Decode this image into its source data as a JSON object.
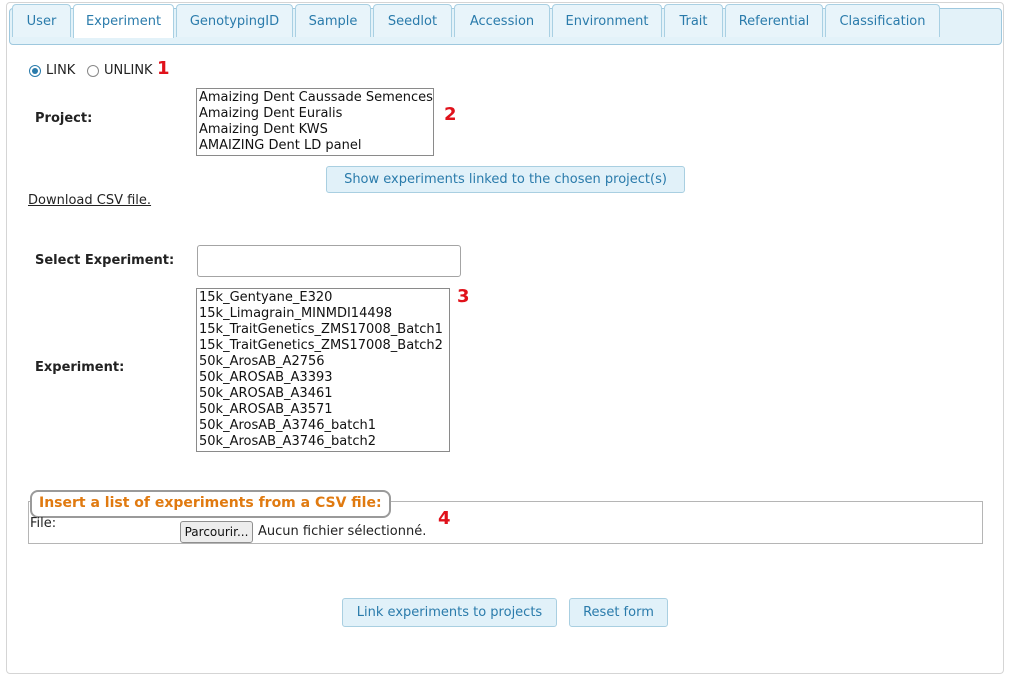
{
  "tabs": [
    {
      "label": "User",
      "active": false
    },
    {
      "label": "Experiment",
      "active": true
    },
    {
      "label": "GenotypingID",
      "active": false
    },
    {
      "label": "Sample",
      "active": false
    },
    {
      "label": "Seedlot",
      "active": false
    },
    {
      "label": "Accession",
      "active": false
    },
    {
      "label": "Environment",
      "active": false
    },
    {
      "label": "Trait",
      "active": false
    },
    {
      "label": "Referential",
      "active": false
    },
    {
      "label": "Classification",
      "active": false
    }
  ],
  "mode": {
    "link_label": "LINK",
    "unlink_label": "UNLINK",
    "selected": "LINK"
  },
  "markers": [
    "1",
    "2",
    "3",
    "4"
  ],
  "project": {
    "label": "Project:",
    "options": [
      "Amaizing Dent Caussade Semences",
      "Amaizing Dent Euralis",
      "Amaizing Dent KWS",
      "AMAIZING Dent LD panel"
    ],
    "show_button": "Show experiments linked to the chosen project(s)"
  },
  "download_link": "Download CSV file.",
  "select_experiment": {
    "label": "Select Experiment:",
    "value": ""
  },
  "experiment": {
    "label": "Experiment:",
    "options": [
      "15k_Gentyane_E320",
      "15k_Limagrain_MINMDI14498",
      "15k_TraitGenetics_ZMS17008_Batch1",
      "15k_TraitGenetics_ZMS17008_Batch2",
      "50k_ArosAB_A2756",
      "50k_AROSAB_A3393",
      "50k_AROSAB_A3461",
      "50k_AROSAB_A3571",
      "50k_ArosAB_A3746_batch1",
      "50k_ArosAB_A3746_batch2"
    ]
  },
  "csv_section": {
    "legend": "Insert a list of experiments from a CSV file:",
    "file_label": "File:",
    "browse_button": "Parcourir...",
    "no_file": "Aucun fichier sélectionné."
  },
  "actions": {
    "link_button": "Link experiments to projects",
    "reset_button": "Reset form"
  },
  "colors": {
    "accent": "#2a7bab",
    "marker": "#e0121b",
    "legend_text": "#e07a10",
    "tab_bg": "#e3f2f9"
  }
}
